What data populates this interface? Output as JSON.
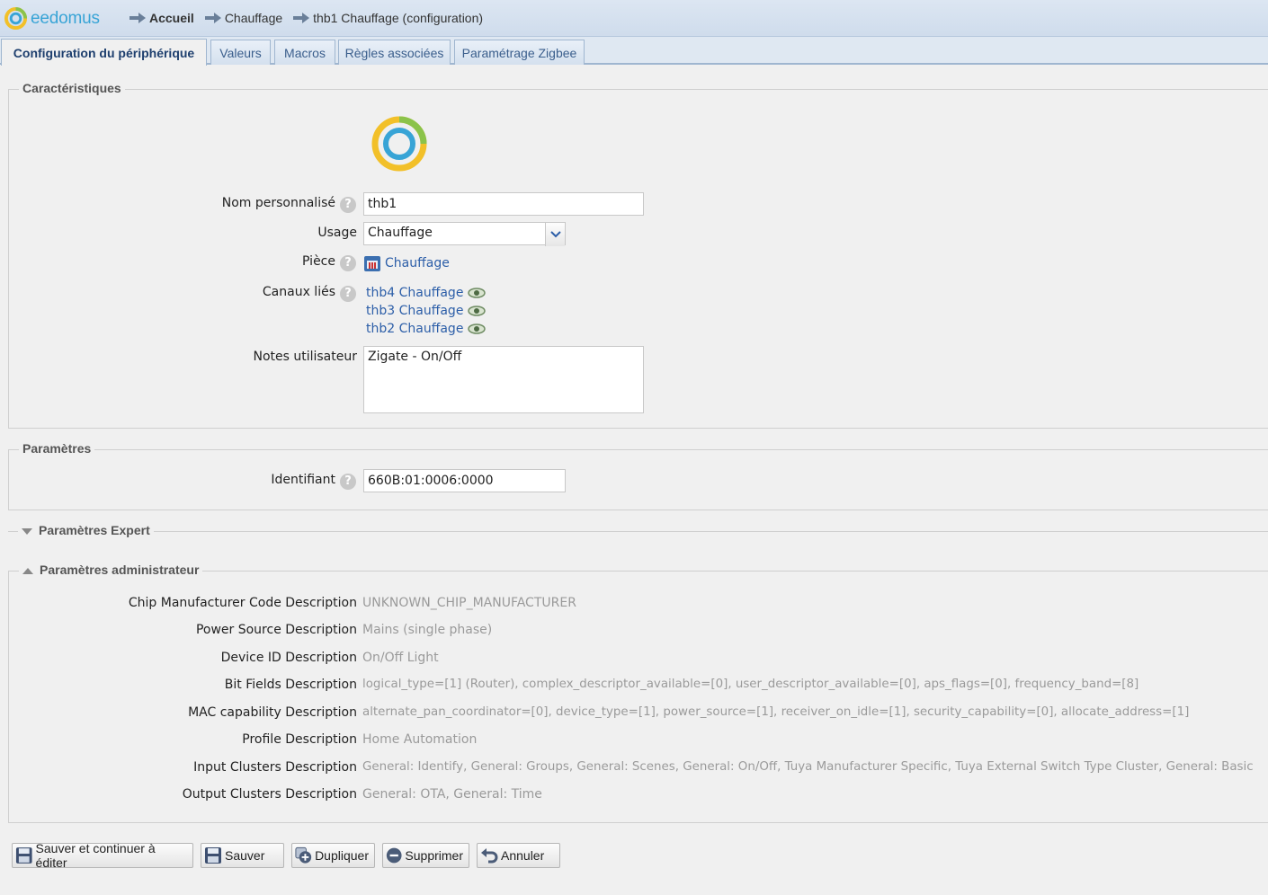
{
  "header": {
    "logo_text": "eedomus",
    "breadcrumbs": [
      {
        "label": "Accueil"
      },
      {
        "label": "Chauffage"
      },
      {
        "label": "thb1 Chauffage (configuration)"
      }
    ]
  },
  "tabs": [
    {
      "label": "Configuration du périphérique",
      "active": true
    },
    {
      "label": "Valeurs"
    },
    {
      "label": "Macros"
    },
    {
      "label": "Règles associées"
    },
    {
      "label": "Paramétrage Zigbee"
    }
  ],
  "characteristics": {
    "legend": "Caractéristiques",
    "name_label": "Nom personnalisé",
    "name_value": "thb1",
    "usage_label": "Usage",
    "usage_value": "Chauffage",
    "room_label": "Pièce",
    "room_value": "Chauffage",
    "channels_label": "Canaux liés",
    "channels": [
      "thb4 Chauffage",
      "thb3 Chauffage",
      "thb2 Chauffage"
    ],
    "notes_label": "Notes utilisateur",
    "notes_value": "Zigate - On/Off"
  },
  "parameters": {
    "legend": "Paramètres",
    "id_label": "Identifiant",
    "id_value": "660B:01:0006:0000"
  },
  "expert": {
    "legend": "Paramètres Expert"
  },
  "admin": {
    "legend": "Paramètres administrateur",
    "rows": [
      {
        "label": "Chip Manufacturer Code Description",
        "value": "UNKNOWN_CHIP_MANUFACTURER"
      },
      {
        "label": "Power Source Description",
        "value": "Mains (single phase)"
      },
      {
        "label": "Device ID Description",
        "value": "On/Off Light"
      },
      {
        "label": "Bit Fields Description",
        "value": "logical_type=[1] (Router), complex_descriptor_available=[0], user_descriptor_available=[0], aps_flags=[0], frequency_band=[8]"
      },
      {
        "label": "MAC capability Description",
        "value": "alternate_pan_coordinator=[0], device_type=[1], power_source=[1], receiver_on_idle=[1], security_capability=[0], allocate_address=[1]"
      },
      {
        "label": "Profile Description",
        "value": "Home Automation"
      },
      {
        "label": "Input Clusters Description",
        "value": "General: Identify, General: Groups, General: Scenes, General: On/Off, Tuya Manufacturer Specific, Tuya External Switch Type Cluster, General: Basic"
      },
      {
        "label": "Output Clusters Description",
        "value": "General: OTA, General: Time"
      }
    ]
  },
  "buttons": {
    "save_continue": "Sauver et continuer à éditer",
    "save": "Sauver",
    "duplicate": "Dupliquer",
    "delete": "Supprimer",
    "cancel": "Annuler"
  },
  "colors": {
    "accent": "#2c5ea8",
    "logo_blue": "#38a4d6",
    "logo_yellow": "#f2c029",
    "logo_green": "#8bc34a"
  }
}
